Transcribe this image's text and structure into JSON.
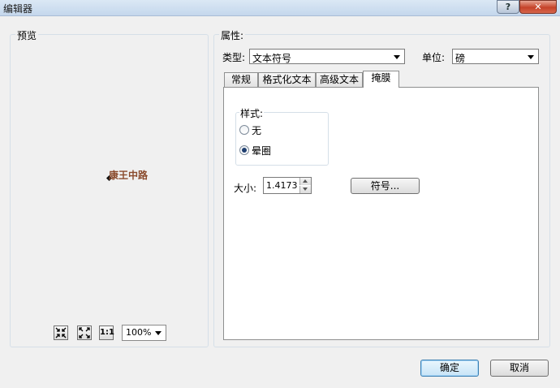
{
  "window": {
    "title": "编辑器",
    "help_label": "?",
    "close_label": "✕"
  },
  "preview": {
    "label": "预览",
    "text": "康王中路",
    "zoom": "100%",
    "tools": [
      "fit-icon",
      "expand-icon",
      "actual-size-icon"
    ],
    "actual_size_label": "1:1"
  },
  "properties": {
    "label": "属性:",
    "type_label": "类型:",
    "type_value": "文本符号",
    "unit_label": "单位:",
    "unit_value": "磅",
    "tabs": [
      {
        "label": "常规"
      },
      {
        "label": "格式化文本"
      },
      {
        "label": "高级文本"
      },
      {
        "label": "掩膜"
      }
    ],
    "active_tab": "掩膜",
    "style_label": "样式:",
    "style_options": [
      {
        "label": "无",
        "selected": false
      },
      {
        "label": "晕圈",
        "selected": true
      }
    ],
    "size_label": "大小:",
    "size_value": "1.4173",
    "symbol_button": "符号..."
  },
  "footer": {
    "ok": "确定",
    "cancel": "取消"
  },
  "colors": {
    "preview_text": "#8a4a2c",
    "default_button": "#3c7fb1"
  }
}
